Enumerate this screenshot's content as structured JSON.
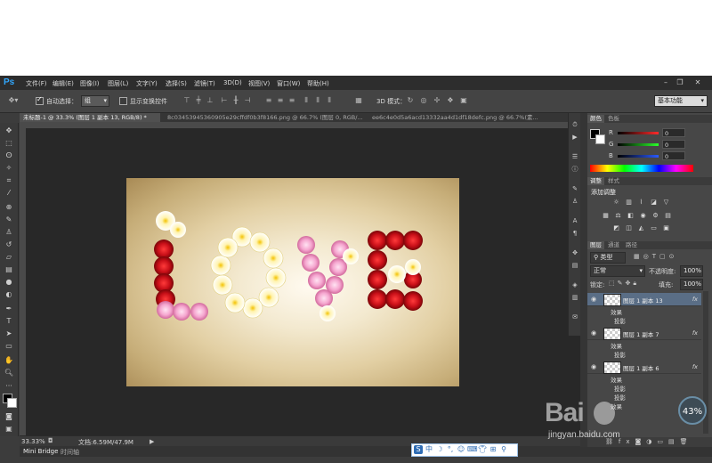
{
  "app": {
    "logo": "Ps"
  },
  "menu": [
    "文件(F)",
    "编辑(E)",
    "图像(I)",
    "图层(L)",
    "文字(Y)",
    "选择(S)",
    "滤镜(T)",
    "3D(D)",
    "视图(V)",
    "窗口(W)",
    "帮助(H)"
  ],
  "options": {
    "auto_select_label": "自动选择：",
    "auto_select_value": "组",
    "show_transform_label": "显示变换控件",
    "mode_3d_label": "3D 模式：",
    "workspace": "基本功能"
  },
  "tabs": [
    {
      "label": "未标题-1 @ 33.3% (图层 1 副本 13, RGB/8) *"
    },
    {
      "label": "8c03453945360905e29cffdf0b3f8166.png @ 66.7% (图层 0, RGB/..."
    },
    {
      "label": "ee6c4e0d5a6acd13332aa4d1df18defc.png @ 66.7%(素..."
    }
  ],
  "status": {
    "zoom": "33.33%",
    "doc": "文档:6.59M/47.9M"
  },
  "bottom_tabs": [
    "Mini Bridge",
    "时间轴"
  ],
  "panel_color": {
    "tabs": [
      "颜色",
      "色板"
    ],
    "channels": [
      {
        "label": "R",
        "value": "0",
        "color": "#ff2a2a"
      },
      {
        "label": "G",
        "value": "0",
        "color": "#2aff2a"
      },
      {
        "label": "B",
        "value": "0",
        "color": "#2a5aff"
      }
    ]
  },
  "panel_adjust": {
    "tabs": [
      "调整",
      "样式"
    ],
    "title": "添加调整"
  },
  "panel_layers": {
    "tabs": [
      "图层",
      "通道",
      "路径"
    ],
    "filter_kind": "类型",
    "blend_mode": "正常",
    "opacity_label": "不透明度:",
    "opacity_value": "100%",
    "lock_label": "锁定:",
    "fill_label": "填充:",
    "fill_value": "100%",
    "layers": [
      {
        "name": "图层 1 副本 13",
        "effect": "效果",
        "sub": "投影",
        "selected": true
      },
      {
        "name": "图层 1 副本 7",
        "effect": "效果",
        "sub": "投影",
        "selected": false
      },
      {
        "name": "图层 1 副本 6",
        "effect": "效果",
        "sub": "投影",
        "selected": false
      }
    ],
    "extra_rows": [
      "投影",
      "效果"
    ]
  },
  "artwork": {
    "text": "LOVE"
  },
  "overlay": {
    "watermark": "Bai",
    "watermark_sub": "jingyan.baidu.com",
    "percent": "43%"
  }
}
